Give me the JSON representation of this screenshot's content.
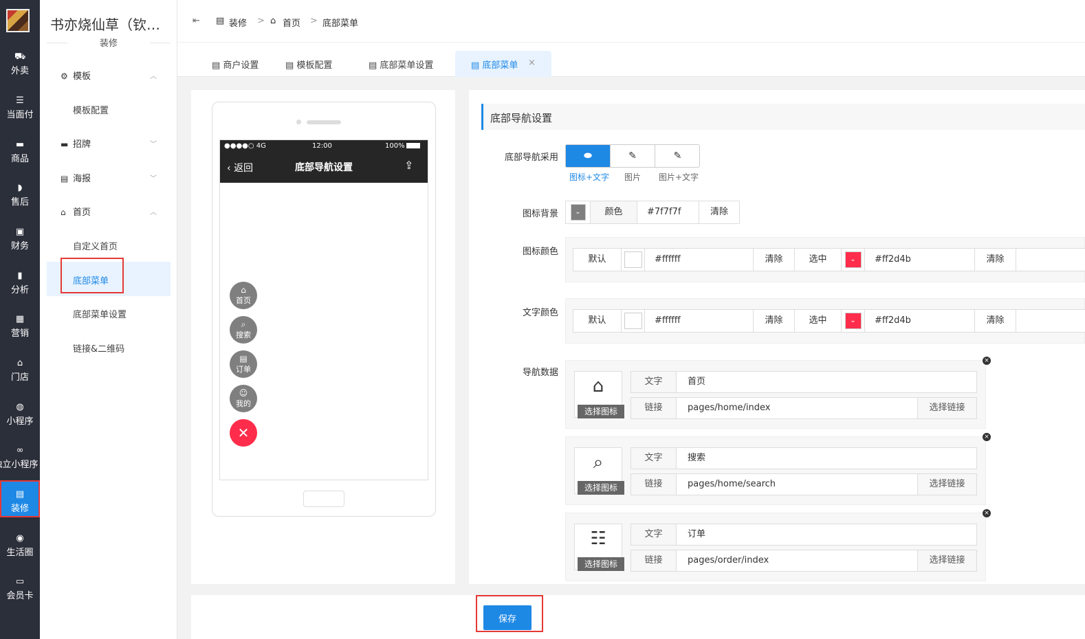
{
  "nav": {
    "items": [
      {
        "icon": "bike-icon",
        "label": "外卖",
        "glyph": "⛟"
      },
      {
        "icon": "list-icon",
        "label": "当面付",
        "glyph": "☰"
      },
      {
        "icon": "gift-icon",
        "label": "商品",
        "glyph": "▬"
      },
      {
        "icon": "headset-icon",
        "label": "售后",
        "glyph": "◗"
      },
      {
        "icon": "finance-icon",
        "label": "财务",
        "glyph": "▣"
      },
      {
        "icon": "bar-chart-icon",
        "label": "分析",
        "glyph": "▮"
      },
      {
        "icon": "gift-box-icon",
        "label": "营销",
        "glyph": "▦"
      },
      {
        "icon": "store-icon",
        "label": "门店",
        "glyph": "⌂"
      },
      {
        "icon": "wechat-icon",
        "label": "小程序",
        "glyph": "◍"
      },
      {
        "icon": "link-icon",
        "label": "独立小程序",
        "glyph": "∞"
      },
      {
        "icon": "shop-icon",
        "label": "装修",
        "glyph": "▤"
      },
      {
        "icon": "circle-icon",
        "label": "生活圈",
        "glyph": "◉"
      },
      {
        "icon": "card-icon",
        "label": "会员卡",
        "glyph": "▭"
      }
    ]
  },
  "sidebar": {
    "shop_name": "书亦烧仙草（钦…",
    "section": "装修",
    "groups": [
      {
        "icon": "gear-icon",
        "glyph": "⚙",
        "label": "模板",
        "expanded": true
      },
      {
        "icon": "signboard-icon",
        "glyph": "▬",
        "label": "招牌",
        "expanded": false
      },
      {
        "icon": "poster-icon",
        "glyph": "▤",
        "label": "海报",
        "expanded": false
      },
      {
        "icon": "home-icon",
        "glyph": "⌂",
        "label": "首页",
        "expanded": true
      }
    ],
    "leaves": {
      "template_config": "模板配置",
      "custom_home": "自定义首页",
      "bottom_menu": "底部菜单",
      "bottom_menu_settings": "底部菜单设置",
      "link_qrcode": "链接&二维码"
    }
  },
  "header": {
    "collapse_glyph": "⇤",
    "breadcrumb": [
      "装修",
      "首页",
      "底部菜单"
    ],
    "separator": ">"
  },
  "tabs": [
    "商户设置",
    "模板配置",
    "底部菜单设置",
    "底部菜单"
  ],
  "tab_close": "×",
  "preview": {
    "signal": "●●●●○ 4G",
    "time": "12:00",
    "battery": "100%",
    "back": "返回",
    "title": "底部导航设置",
    "fabs": [
      {
        "icon": "home-icon",
        "glyph": "⌂",
        "label": "首页"
      },
      {
        "icon": "search-icon",
        "glyph": "⌕",
        "label": "搜索"
      },
      {
        "icon": "order-icon",
        "glyph": "▤",
        "label": "订单"
      },
      {
        "icon": "user-icon",
        "glyph": "☺",
        "label": "我的"
      }
    ],
    "close_glyph": "✕"
  },
  "form": {
    "section_title": "底部导航设置",
    "nav_mode_label": "底部导航采用",
    "nav_modes": [
      "图标+文字",
      "图片",
      "图片+文字"
    ],
    "nav_mode_selected": 0,
    "icon_bg_label": "图标背景",
    "icon_bg": {
      "color_btn": "颜色",
      "value": "#7f7f7f",
      "clear": "清除"
    },
    "icon_color_label": "图标颜色",
    "text_color_label": "文字颜色",
    "color_pair": {
      "default_label": "默认",
      "default_value": "#ffffff",
      "selected_label": "选中",
      "selected_value": "#ff2d4b",
      "clear": "清除"
    },
    "nav_data_label": "导航数据",
    "text_key": "文字",
    "link_key": "链接",
    "choose_link": "选择链接",
    "choose_icon": "选择图标",
    "nav_items": [
      {
        "icon": "home-outline-icon",
        "glyph": "⌂",
        "text": "首页",
        "link": "pages/home/index"
      },
      {
        "icon": "search-outline-icon",
        "glyph": "⌕",
        "text": "搜索",
        "link": "pages/home/search"
      },
      {
        "icon": "order-outline-icon",
        "glyph": "☷",
        "text": "订单",
        "link": "pages/order/index"
      }
    ]
  },
  "footer": {
    "save": "保存"
  },
  "colors": {
    "accent": "#1e88e5",
    "red": "#ff2d4b",
    "nav_bg": "#2b2f3a"
  }
}
